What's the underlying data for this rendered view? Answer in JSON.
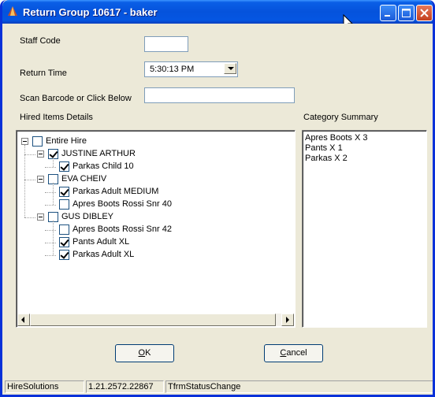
{
  "window": {
    "title": "Return Group 10617 - baker"
  },
  "form": {
    "staff_code_label": "Staff Code",
    "staff_code_value": "",
    "return_time_label": "Return Time",
    "return_time_value": "5:30:13 PM",
    "scan_label": "Scan Barcode or Click Below",
    "scan_value": "",
    "hired_items_label": "Hired Items Details",
    "category_label": "Category Summary"
  },
  "tree": [
    {
      "label": "Entire Hire",
      "checked": false,
      "level": 0,
      "expander": true
    },
    {
      "label": "JUSTINE ARTHUR",
      "checked": true,
      "level": 1,
      "expander": true
    },
    {
      "label": "Parkas Child 10",
      "checked": true,
      "level": 2,
      "expander": false
    },
    {
      "label": "EVA CHEIV",
      "checked": false,
      "level": 1,
      "expander": true
    },
    {
      "label": "Parkas Adult MEDIUM",
      "checked": true,
      "level": 2,
      "expander": false
    },
    {
      "label": "Apres Boots Rossi Snr 40",
      "checked": false,
      "level": 2,
      "expander": false
    },
    {
      "label": "GUS DIBLEY",
      "checked": false,
      "level": 1,
      "expander": true
    },
    {
      "label": "Apres Boots Rossi Snr 42",
      "checked": false,
      "level": 2,
      "expander": false
    },
    {
      "label": "Pants Adult XL",
      "checked": true,
      "level": 2,
      "expander": false
    },
    {
      "label": "Parkas Adult XL",
      "checked": true,
      "level": 2,
      "expander": false
    }
  ],
  "category_summary": [
    "Apres Boots X 3",
    "Pants X 1",
    "Parkas X 2"
  ],
  "buttons": {
    "ok_accel": "O",
    "ok_rest": "K",
    "cancel_accel": "C",
    "cancel_rest": "ancel"
  },
  "statusbar": {
    "app": "HireSolutions",
    "version": "1.21.2572.22867",
    "form": "TfrmStatusChange"
  },
  "colors": {
    "titlebar": "#0553dc",
    "face": "#ece9d8"
  }
}
